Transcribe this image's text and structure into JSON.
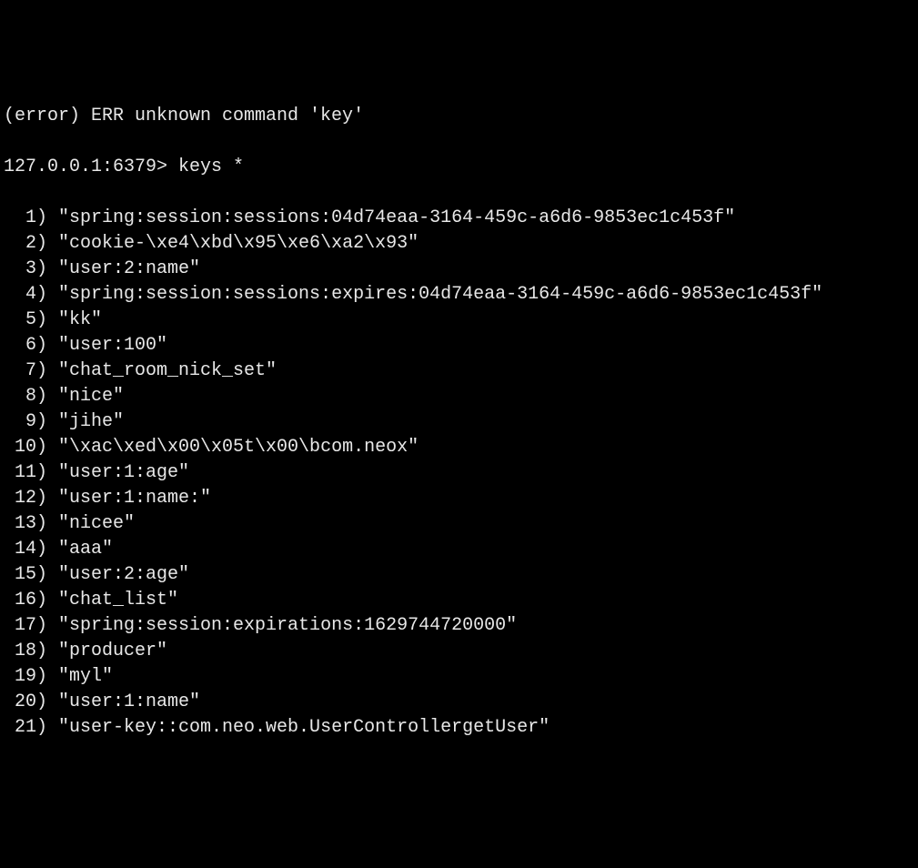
{
  "error_line": "(error) ERR unknown command 'key'",
  "prompt": "127.0.0.1:6379> ",
  "command": "keys *",
  "results": [
    {
      "n": "1",
      "v": "\"spring:session:sessions:04d74eaa-3164-459c-a6d6-9853ec1c453f\""
    },
    {
      "n": "2",
      "v": "\"cookie-\\xe4\\xbd\\x95\\xe6\\xa2\\x93\""
    },
    {
      "n": "3",
      "v": "\"user:2:name\""
    },
    {
      "n": "4",
      "v": "\"spring:session:sessions:expires:04d74eaa-3164-459c-a6d6-9853ec1c453f\""
    },
    {
      "n": "5",
      "v": "\"kk\""
    },
    {
      "n": "6",
      "v": "\"user:100\""
    },
    {
      "n": "7",
      "v": "\"chat_room_nick_set\""
    },
    {
      "n": "8",
      "v": "\"nice\""
    },
    {
      "n": "9",
      "v": "\"jihe\""
    },
    {
      "n": "10",
      "v": "\"\\xac\\xed\\x00\\x05t\\x00\\bcom.neox\""
    },
    {
      "n": "11",
      "v": "\"user:1:age\""
    },
    {
      "n": "12",
      "v": "\"user:1:name:\""
    },
    {
      "n": "13",
      "v": "\"nicee\""
    },
    {
      "n": "14",
      "v": "\"aaa\""
    },
    {
      "n": "15",
      "v": "\"user:2:age\""
    },
    {
      "n": "16",
      "v": "\"chat_list\""
    },
    {
      "n": "17",
      "v": "\"spring:session:expirations:1629744720000\""
    },
    {
      "n": "18",
      "v": "\"producer\""
    },
    {
      "n": "19",
      "v": "\"myl\""
    },
    {
      "n": "20",
      "v": "\"user:1:name\""
    },
    {
      "n": "21",
      "v": "\"user-key::com.neo.web.UserControllergetUser\""
    }
  ]
}
